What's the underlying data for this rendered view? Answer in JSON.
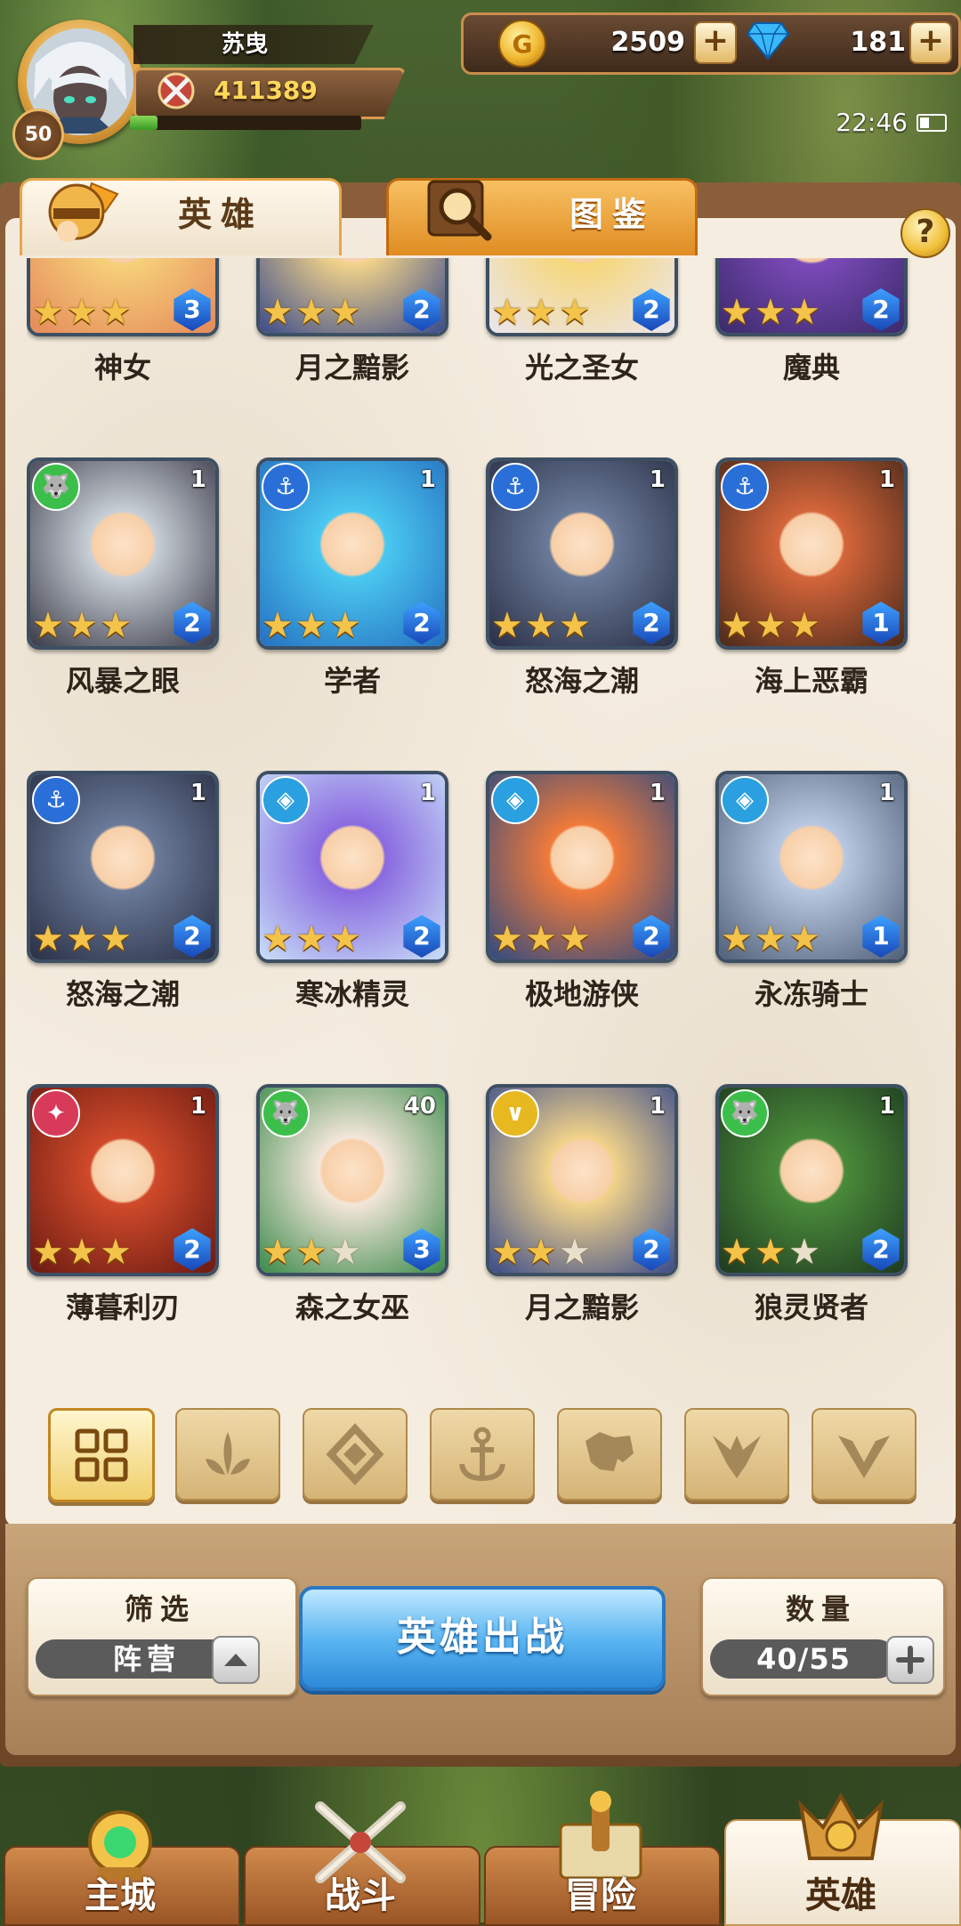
{
  "player": {
    "name": "苏曳",
    "level": "50",
    "power": "411389",
    "xp_fraction": 0.12
  },
  "resources": {
    "gold": "2509",
    "gems": "181",
    "plus": "+"
  },
  "status": {
    "time": "22:46"
  },
  "tabs": [
    {
      "label": "英雄",
      "active": true
    },
    {
      "label": "图鉴",
      "active": false
    }
  ],
  "help": "?",
  "heroes": [
    {
      "name": "神女",
      "level": "",
      "faction": "",
      "stars": 3,
      "rank": "3",
      "bg": [
        "#f6d07a",
        "#e58a5a"
      ]
    },
    {
      "name": "月之黯影",
      "level": "",
      "faction": "",
      "stars": 3,
      "rank": "2",
      "bg": [
        "#f2d38a",
        "#3a4b8a"
      ]
    },
    {
      "name": "光之圣女",
      "level": "",
      "faction": "",
      "stars": 3,
      "rank": "2",
      "bg": [
        "#f6d77a",
        "#eae6f0"
      ]
    },
    {
      "name": "魔典",
      "level": "",
      "faction": "",
      "stars": 3,
      "rank": "2",
      "bg": [
        "#7a4ab8",
        "#3b2a6a"
      ]
    },
    {
      "name": "风暴之眼",
      "level": "1",
      "faction": "wolf",
      "stars": 3,
      "rank": "2",
      "bg": [
        "#c8cfd6",
        "#3a3a48"
      ]
    },
    {
      "name": "学者",
      "level": "1",
      "faction": "anchor",
      "stars": 3,
      "rank": "2",
      "bg": [
        "#4ac8f0",
        "#2670c0"
      ]
    },
    {
      "name": "怒海之潮",
      "level": "1",
      "faction": "anchor",
      "stars": 3,
      "rank": "2",
      "bg": [
        "#6a7a98",
        "#2a3046"
      ]
    },
    {
      "name": "海上恶霸",
      "level": "1",
      "faction": "anchor",
      "stars": 3,
      "rank": "1",
      "bg": [
        "#d5653a",
        "#4a2a1a"
      ]
    },
    {
      "name": "怒海之潮",
      "level": "1",
      "faction": "anchor",
      "stars": 3,
      "rank": "2",
      "bg": [
        "#6a7a98",
        "#2a3046"
      ]
    },
    {
      "name": "寒冰精灵",
      "level": "1",
      "faction": "ice",
      "stars": 3,
      "rank": "2",
      "bg": [
        "#8a6ae0",
        "#c8dff8"
      ]
    },
    {
      "name": "极地游侠",
      "level": "1",
      "faction": "ice",
      "stars": 3,
      "rank": "2",
      "bg": [
        "#f07a3a",
        "#304a80"
      ]
    },
    {
      "name": "永冻骑士",
      "level": "1",
      "faction": "ice",
      "stars": 3,
      "rank": "1",
      "bg": [
        "#b8c8e0",
        "#506078"
      ]
    },
    {
      "name": "薄暮利刃",
      "level": "1",
      "faction": "fire",
      "stars": 3,
      "rank": "2",
      "bg": [
        "#d04a2a",
        "#6a1a12"
      ]
    },
    {
      "name": "森之女巫",
      "level": "40",
      "faction": "wolf",
      "stars": 2,
      "rank": "3",
      "bg": [
        "#f4e6da",
        "#3a8a4a"
      ]
    },
    {
      "name": "月之黯影",
      "level": "1",
      "faction": "light",
      "stars": 2,
      "rank": "2",
      "bg": [
        "#f2d38a",
        "#3a4b8a"
      ]
    },
    {
      "name": "狼灵贤者",
      "level": "1",
      "faction": "wolf",
      "stars": 2,
      "rank": "2",
      "bg": [
        "#4a8a3a",
        "#1e3a20"
      ]
    }
  ],
  "filters": [
    "all",
    "fire",
    "ice",
    "anchor",
    "wolf",
    "dark",
    "light"
  ],
  "controls": {
    "filter_title": "筛选",
    "filter_value": "阵营",
    "deploy_label": "英雄出战",
    "count_title": "数量",
    "count_value": "40/55"
  },
  "nav": [
    {
      "label": "主城",
      "active": false
    },
    {
      "label": "战斗",
      "active": false
    },
    {
      "label": "冒险",
      "active": false
    },
    {
      "label": "英雄",
      "active": true
    }
  ],
  "colors": {
    "gold_text": "#ffd75a",
    "rank_blue": "#1e64d0",
    "deploy_blue": "#4aa8ee"
  }
}
